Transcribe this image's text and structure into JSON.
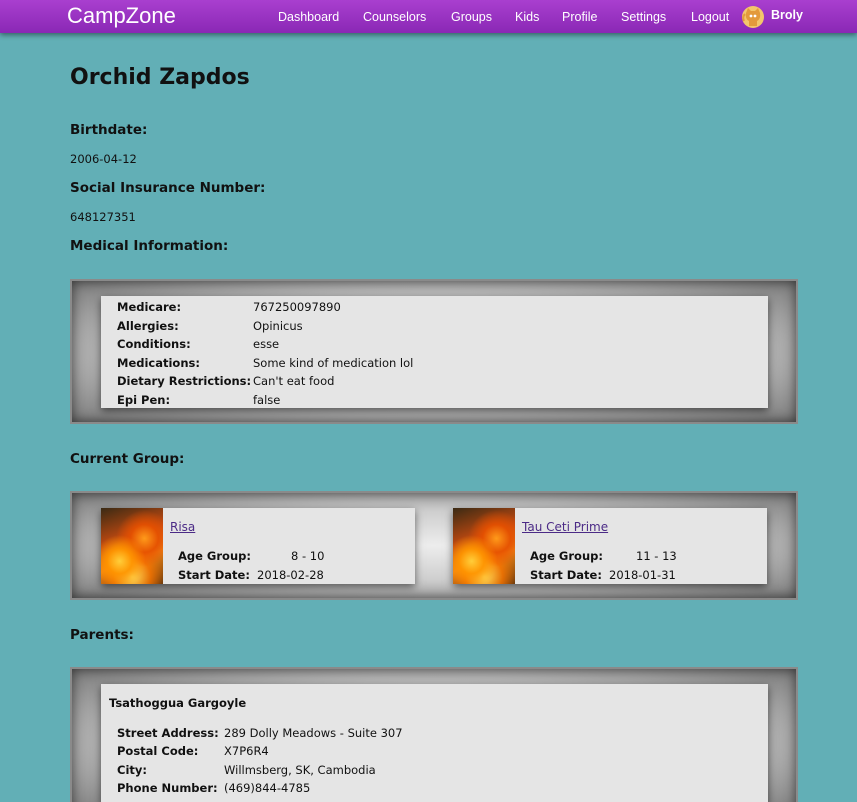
{
  "app": {
    "brand": "CampZone",
    "nav": [
      "Dashboard",
      "Counselors",
      "Groups",
      "Kids",
      "Profile",
      "Settings",
      "Logout"
    ],
    "username": "Broly",
    "avatar_icon": "octocat-avatar-icon"
  },
  "kid": {
    "name": "Orchid Zapdos",
    "birthdate_label": "Birthdate:",
    "birthdate": "2006-04-12",
    "sin_label": "Social Insurance Number:",
    "sin": "648127351",
    "medical_label": "Medical Information:"
  },
  "medical": [
    {
      "key": "Medicare:",
      "value": "767250097890"
    },
    {
      "key": "Allergies:",
      "value": "Opinicus"
    },
    {
      "key": "Conditions:",
      "value": "esse"
    },
    {
      "key": "Medications:",
      "value": "Some kind of medication lol"
    },
    {
      "key": "Dietary Restrictions:",
      "value": "Can't eat food"
    },
    {
      "key": "Epi Pen:",
      "value": "false"
    }
  ],
  "groups_label": "Current Group:",
  "groups": [
    {
      "name": "Risa",
      "age_group_label": "Age Group:",
      "age_group": "8 - 10",
      "start_label": "Start Date:",
      "start_date": "2018-02-28"
    },
    {
      "name": "Tau Ceti Prime",
      "age_group_label": "Age Group:",
      "age_group": "11 - 13",
      "start_label": "Start Date:",
      "start_date": "2018-01-31"
    }
  ],
  "parents_label": "Parents:",
  "parent": {
    "name": "Tsathoggua Gargoyle",
    "fields": [
      {
        "key": "Street Address:",
        "value": "289 Dolly Meadows - Suite 307"
      },
      {
        "key": "Postal Code:",
        "value": "X7P6R4"
      },
      {
        "key": "City:",
        "value": "Willmsberg, SK, Cambodia"
      },
      {
        "key": "Phone Number:",
        "value": "(469)844-4785"
      }
    ]
  }
}
